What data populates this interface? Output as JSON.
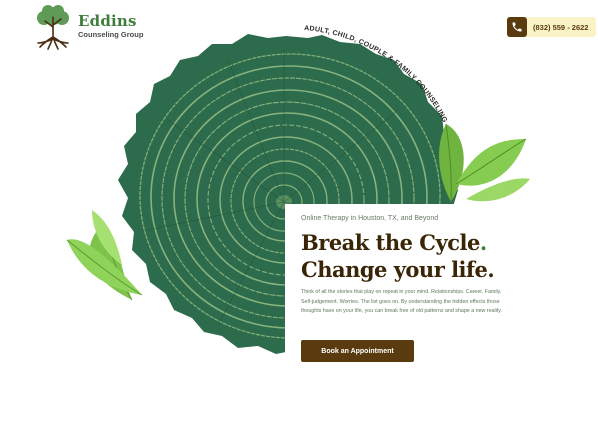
{
  "brand": {
    "name": "Eddins",
    "subtitle": "Counseling Group",
    "colors": {
      "green": "#3f7d3a",
      "brown": "#5a3b10",
      "highlight": "#faf3c8"
    }
  },
  "header": {
    "phone_icon": "phone-icon",
    "phone_number": "(832) 559 - 2622"
  },
  "hero": {
    "curved_tagline": "ADULT, CHILD, COUPLE & FAMILY COUNSELING",
    "eyebrow": "Online Therapy in Houston, TX, and Beyond",
    "headline_line1": "Break the Cycle",
    "headline_line1_punct": ".",
    "headline_line2": "Change your life.",
    "body": "Think of all the stories that play on repeat in your mind. Relationships. Career. Family. Self-judgement. Worries. The list goes on. By understanding the hidden effects those thoughts have on your life, you can break free of old patterns and shape a new reality.",
    "cta_label": "Book an Appointment"
  }
}
